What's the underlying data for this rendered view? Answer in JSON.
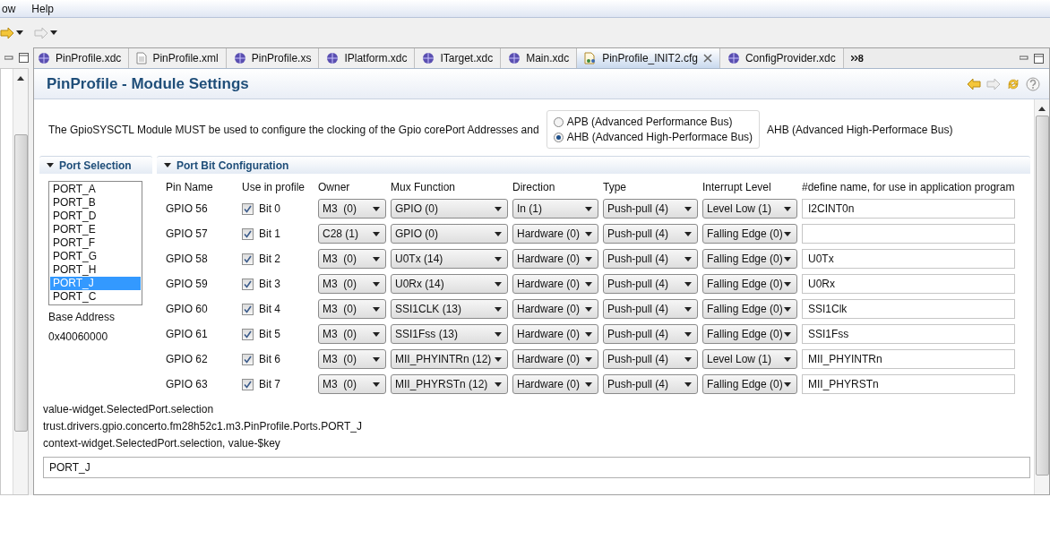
{
  "menu_bar": [
    "ow",
    "Help"
  ],
  "tabs": [
    {
      "label": "PinProfile.xdc",
      "kind": "module",
      "selected": false
    },
    {
      "label": "PinProfile.xml",
      "kind": "file",
      "selected": false
    },
    {
      "label": "PinProfile.xs",
      "kind": "module",
      "selected": false
    },
    {
      "label": "IPlatform.xdc",
      "kind": "module",
      "selected": false
    },
    {
      "label": "ITarget.xdc",
      "kind": "module",
      "selected": false
    },
    {
      "label": "Main.xdc",
      "kind": "module",
      "selected": false
    },
    {
      "label": "PinProfile_INIT2.cfg",
      "kind": "config",
      "selected": true
    },
    {
      "label": "ConfigProvider.xdc",
      "kind": "module",
      "selected": false
    }
  ],
  "tab_overflow": "8",
  "editor": {
    "title": "PinProfile - Module Settings",
    "intro": "The GpioSYSCTL Module MUST be used to configure the clocking of the Gpio corePort Addresses and",
    "bus_options": [
      {
        "label": "APB (Advanced Performance Bus)",
        "selected": false
      },
      {
        "label": "AHB (Advanced High-Performace Bus)",
        "selected": true
      }
    ],
    "bus_value": "AHB (Advanced High-Performace Bus)",
    "port_selection": {
      "title": "Port Selection",
      "ports": [
        {
          "label": "PORT_A",
          "selected": false
        },
        {
          "label": "PORT_B",
          "selected": false
        },
        {
          "label": "PORT_D",
          "selected": false
        },
        {
          "label": "PORT_E",
          "selected": false
        },
        {
          "label": "PORT_F",
          "selected": false
        },
        {
          "label": "PORT_G",
          "selected": false
        },
        {
          "label": "PORT_H",
          "selected": false
        },
        {
          "label": "PORT_J",
          "selected": true
        },
        {
          "label": "PORT_C",
          "selected": false
        }
      ],
      "base_address_label": "Base Address",
      "base_address": "0x40060000"
    },
    "port_bit_configuration": {
      "title": "Port Bit Configuration",
      "columns": [
        "Pin Name",
        "Use in profile",
        "Owner",
        "Mux Function",
        "Direction",
        "Type",
        "Interrupt Level",
        "#define name, for use in application program"
      ],
      "rows": [
        {
          "pin": "GPIO 56",
          "checked": true,
          "bit": "Bit 0",
          "owner": "M3  (0)",
          "mux": "GPIO (0)",
          "direction": "In (1)",
          "type": "Push-pull (4)",
          "interrupt": "Level Low (1)",
          "define": "I2CINT0n"
        },
        {
          "pin": "GPIO 57",
          "checked": true,
          "bit": "Bit 1",
          "owner": "C28 (1)",
          "mux": "GPIO (0)",
          "direction": "Hardware (0)",
          "type": "Push-pull (4)",
          "interrupt": "Falling Edge (0)"
        },
        {
          "pin": "GPIO 58",
          "checked": true,
          "bit": "Bit 2",
          "owner": "M3  (0)",
          "mux": "U0Tx (14)",
          "direction": "Hardware (0)",
          "type": "Push-pull (4)",
          "interrupt": "Falling Edge (0)",
          "define": "U0Tx"
        },
        {
          "pin": "GPIO 59",
          "checked": true,
          "bit": "Bit 3",
          "owner": "M3  (0)",
          "mux": "U0Rx (14)",
          "direction": "Hardware (0)",
          "type": "Push-pull (4)",
          "interrupt": "Falling Edge (0)",
          "define": "U0Rx"
        },
        {
          "pin": "GPIO 60",
          "checked": true,
          "bit": "Bit 4",
          "owner": "M3  (0)",
          "mux": "SSI1CLK (13)",
          "direction": "Hardware (0)",
          "type": "Push-pull (4)",
          "interrupt": "Falling Edge (0)",
          "define": "SSI1Clk"
        },
        {
          "pin": "GPIO 61",
          "checked": true,
          "bit": "Bit 5",
          "owner": "M3  (0)",
          "mux": "SSI1Fss (13)",
          "direction": "Hardware (0)",
          "type": "Push-pull (4)",
          "interrupt": "Falling Edge (0)",
          "define": "SSI1Fss"
        },
        {
          "pin": "GPIO 62",
          "checked": true,
          "bit": "Bit 6",
          "owner": "M3  (0)",
          "mux": "MII_PHYINTRn (12)",
          "direction": "Hardware (0)",
          "type": "Push-pull (4)",
          "interrupt": "Level Low (1)",
          "define": "MII_PHYINTRn"
        },
        {
          "pin": "GPIO 63",
          "checked": true,
          "bit": "Bit 7",
          "owner": "M3  (0)",
          "mux": "MII_PHYRSTn (12)",
          "direction": "Hardware (0)",
          "type": "Push-pull (4)",
          "interrupt": "Falling Edge (0)",
          "define": "MII_PHYRSTn"
        }
      ]
    },
    "debug_lines": [
      "value-widget.SelectedPort.selection",
      "trust.drivers.gpio.concerto.fm28h52c1.m3.PinProfile.Ports.PORT_J",
      "context-widget.SelectedPort.selection, value-$key"
    ],
    "key_field": "PORT_J"
  }
}
